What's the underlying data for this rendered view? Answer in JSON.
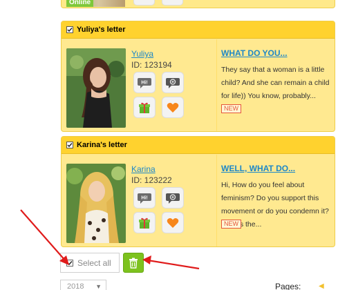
{
  "top_card": {
    "status_badge": "Online"
  },
  "letters": [
    {
      "title": "Yuliya's letter",
      "name": "Yuliya",
      "id_text": "ID: 123194",
      "subject": "WHAT DO YOU...",
      "excerpt": "They say that a woman is a little child? And she can remain a child for life)) You know, probably...",
      "badge": "NEW"
    },
    {
      "title": "Karina's letter",
      "name": "Karina",
      "id_text": "ID: 123222",
      "subject": "WELL, WHAT DO...",
      "excerpt": "Hi, How do you feel about feminism? Do you support this movement or do you condemn it? Across the...",
      "badge": "NEW"
    }
  ],
  "actions": {
    "select_all_label": "Select all"
  },
  "footer": {
    "year_value": "2018",
    "pages_label": "Pages:"
  },
  "colors": {
    "card_header": "#ffd22e",
    "card_body": "#ffe990",
    "link": "#1d87c7",
    "badge_new": "#e5553a",
    "trash_button": "#7dc21e",
    "arrow": "#e01b1b"
  },
  "icons": {
    "chat": "chat-icon",
    "video": "video-icon",
    "gift": "gift-icon",
    "like": "heart-icon",
    "delete": "trash-icon"
  }
}
